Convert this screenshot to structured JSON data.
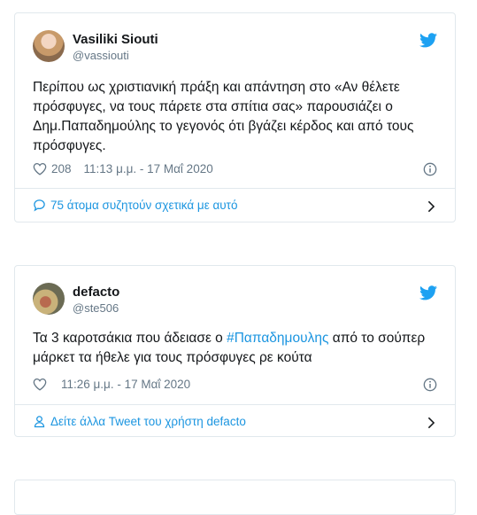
{
  "tweets": [
    {
      "name": "Vasiliki Siouti",
      "handle": "@vassiouti",
      "text": "Περίπου ως χριστιανική πράξη και απάντηση στο «Αν θέλετε πρόσφυγες, να τους πάρετε στα σπίτια σας» παρουσιάζει ο Δημ.Παπαδημούλης το γεγονός ότι βγάζει κέρδος και από τους πρόσφυγες.",
      "likes": "208",
      "timestamp": "11:13 μ.μ. - 17 Μαΐ 2020",
      "footer": "75 άτομα συζητούν σχετικά με αυτό",
      "footer_icon": "speech-bubble-icon"
    },
    {
      "name": "defacto",
      "handle": "@ste506",
      "text_before": "Τα 3 καροτσάκια που άδειασε ο ",
      "hashtag": "#Παπαδημουλης",
      "text_after": " από το σούπερ μάρκετ τα ήθελε για τους πρόσφυγες ρε κούτα",
      "likes": "",
      "timestamp": "11:26 μ.μ. - 17 Μαΐ 2020",
      "footer": "Δείτε άλλα Tweet του χρήστη defacto",
      "footer_icon": "person-icon"
    }
  ],
  "colors": {
    "link": "#1b95e0",
    "secondary_text": "#657786",
    "border": "#e1e8ed",
    "twitter_blue": "#1da1f2"
  }
}
